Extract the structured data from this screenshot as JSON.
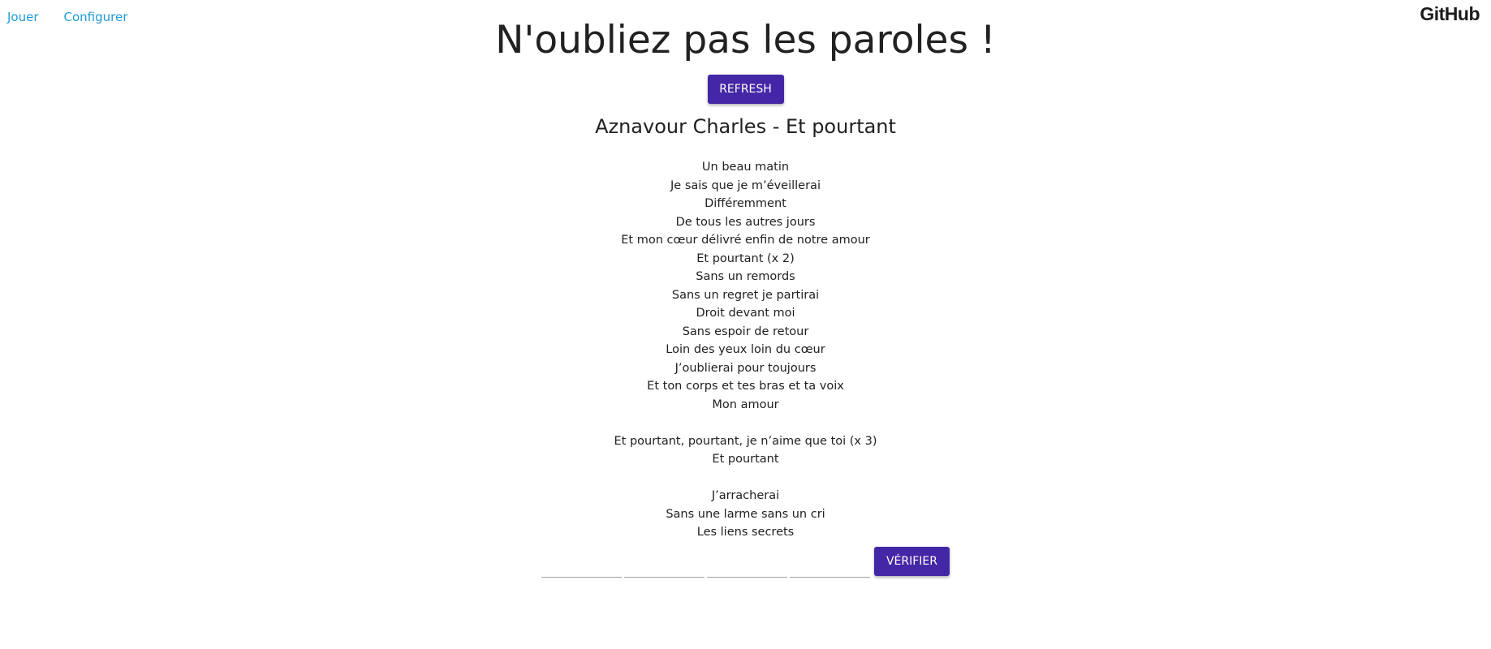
{
  "nav": {
    "play_label": "Jouer",
    "configure_label": "Configurer",
    "github_label": "GitHub"
  },
  "page": {
    "title": "N'oubliez pas les paroles !",
    "refresh_label": "REFRESH",
    "song_title": "Aznavour Charles - Et pourtant"
  },
  "lyrics": [
    "Un beau matin",
    "Je sais que je m’éveillerai",
    "Différemment",
    "De tous les autres jours",
    "Et mon cœur délivré enfin de notre amour",
    "Et pourtant (x 2)",
    "Sans un remords",
    "Sans un regret je partirai",
    "Droit devant moi",
    "Sans espoir de retour",
    "Loin des yeux loin du cœur",
    "J’oublierai pour toujours",
    "Et ton corps et tes bras et ta voix",
    "Mon amour",
    "",
    "Et pourtant, pourtant, je n’aime que toi (x 3)",
    "Et pourtant",
    "",
    "J’arracherai",
    "Sans une larme sans un cri",
    "Les liens secrets"
  ],
  "answer": {
    "inputs": [
      "",
      "",
      "",
      ""
    ],
    "verify_label": "VÉRIFIER"
  },
  "colors": {
    "accent": "#4427a6",
    "link": "#1e9bd7"
  }
}
